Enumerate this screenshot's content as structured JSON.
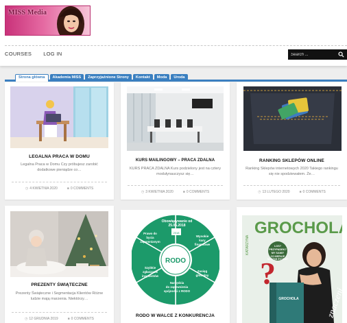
{
  "logo": {
    "text": "MISS Media"
  },
  "nav": {
    "items": [
      "COURSES",
      "LOG IN"
    ]
  },
  "search": {
    "placeholder": "Search ..."
  },
  "tabs": [
    "Strona główna",
    "Akademia MISS",
    "Zaprzyjaźnione Strony",
    "Kontakt",
    "Moda",
    "Uroda"
  ],
  "active_tab": "Strona główna",
  "colors": {
    "accent": "#3a7fc0",
    "search_bg": "#111111"
  },
  "posts": [
    {
      "title": "LEGALNA PRACA W DOMU",
      "excerpt": "Legalna Praca w Domu Czy próbujesz zarobić dodatkowe pieniądze co…",
      "date": "4 KWIETNIA 2020",
      "comments": "0 COMMENTS"
    },
    {
      "title": "KURS MAILINGOWY – PRACA ZDALNA",
      "excerpt": "KURS PRACA ZDALNA Kurs podzielony jest na cztery modułynauczysz się…",
      "date": "3 KWIETNIA 2020",
      "comments": "0 COMMENTS"
    },
    {
      "title": "RANKING SKLEPÓW ONLINE",
      "excerpt": "Ranking Sklepów internetowych 2020 Takiego rankingu się nie spodziewałem. Że…",
      "date": "13 LUTEGO 2020",
      "comments": "0 COMMENTS"
    },
    {
      "title": "PREZENTY ŚWIĄTECZNE",
      "excerpt": "Prezenty Świąteczne i Segmentacja Klientów Różne ludzie mają marzenia. Niektórzy…",
      "date": "12 GRUDNIA 2019",
      "comments": "0 COMMENTS"
    },
    {
      "title": "RODO W WALCE Z KONKURENCJA",
      "excerpt": "",
      "date": "",
      "comments": ""
    },
    {
      "title": "",
      "excerpt": "",
      "date": "",
      "comments": ""
    }
  ],
  "rodo_graphic": {
    "center": "RODO",
    "segments": [
      "Obowiązywanie od 25.05.2018",
      "Wysokie kary finansowe",
      "Zasięg globalny",
      "Narzędzia do zapewnienia spójności z RODO",
      "Szybkie zgłaszanie incydentów",
      "Prawo do bycia zapomnianym"
    ],
    "calendar": "2018"
  },
  "book_cover": {
    "author": "KATARZYNA",
    "title": "GROCHOLA",
    "bubble": "LOS? PRZYPADEK? MY SAMI? CO KIERUJE NASZYM ŻYCIEM?",
    "spine": "GROCHOLA",
    "script_text": "znaczeni"
  }
}
